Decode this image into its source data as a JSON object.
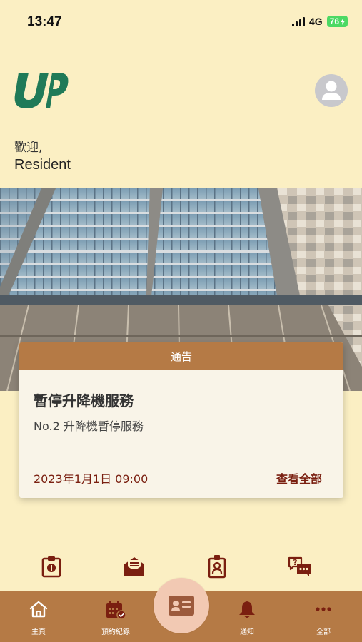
{
  "status_bar": {
    "time": "13:47",
    "network": "4G",
    "battery": "76"
  },
  "home": {
    "greeting": "歡迎,",
    "username": "Resident"
  },
  "notice": {
    "header": "通告",
    "title": "暫停升降機服務",
    "body": "No.2 升降機暫停服務",
    "date": "2023年1月1日 09:00",
    "view_all": "查看全部"
  },
  "tabbar": {
    "items": [
      {
        "label": "主頁",
        "icon": "home-icon"
      },
      {
        "label": "預約紀錄",
        "icon": "calendar-check-icon"
      },
      {
        "label": "通知",
        "icon": "bell-icon"
      },
      {
        "label": "全部",
        "icon": "more-icon"
      }
    ],
    "center_icon": "id-card-icon"
  },
  "quick_actions": [
    {
      "icon": "clipboard-alert-icon"
    },
    {
      "icon": "mail-open-icon"
    },
    {
      "icon": "badge-icon"
    },
    {
      "icon": "chat-question-icon"
    }
  ],
  "colors": {
    "background": "#fbefc3",
    "accent": "#b57a45",
    "dark_red": "#7a1f10",
    "logo_green": "#1f7a58"
  }
}
